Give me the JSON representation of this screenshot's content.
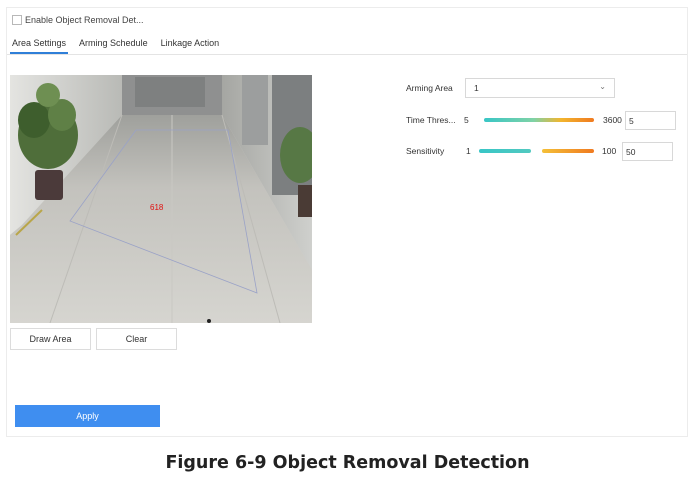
{
  "enable": {
    "label": "Enable Object Removal Det...",
    "checked": false
  },
  "tabs": [
    {
      "label": "Area Settings",
      "active": true
    },
    {
      "label": "Arming Schedule",
      "active": false
    },
    {
      "label": "Linkage Action",
      "active": false
    }
  ],
  "video": {
    "overlay_text": "618"
  },
  "buttons": {
    "draw_area": "Draw Area",
    "clear": "Clear",
    "apply": "Apply"
  },
  "settings": {
    "arming_area": {
      "label": "Arming Area",
      "value": "1"
    },
    "time_threshold": {
      "label": "Time Thres...",
      "min": "5",
      "max": "3600",
      "value": "5"
    },
    "sensitivity": {
      "label": "Sensitivity",
      "min": "1",
      "max": "100",
      "value": "50"
    }
  },
  "caption": "Figure 6-9 Object Removal Detection",
  "colors": {
    "accent": "#3f8ef0",
    "slider_start": "#38c6c6",
    "slider_end": "#f07a20"
  },
  "icons": {
    "dropdown": "chevron-down-icon"
  }
}
